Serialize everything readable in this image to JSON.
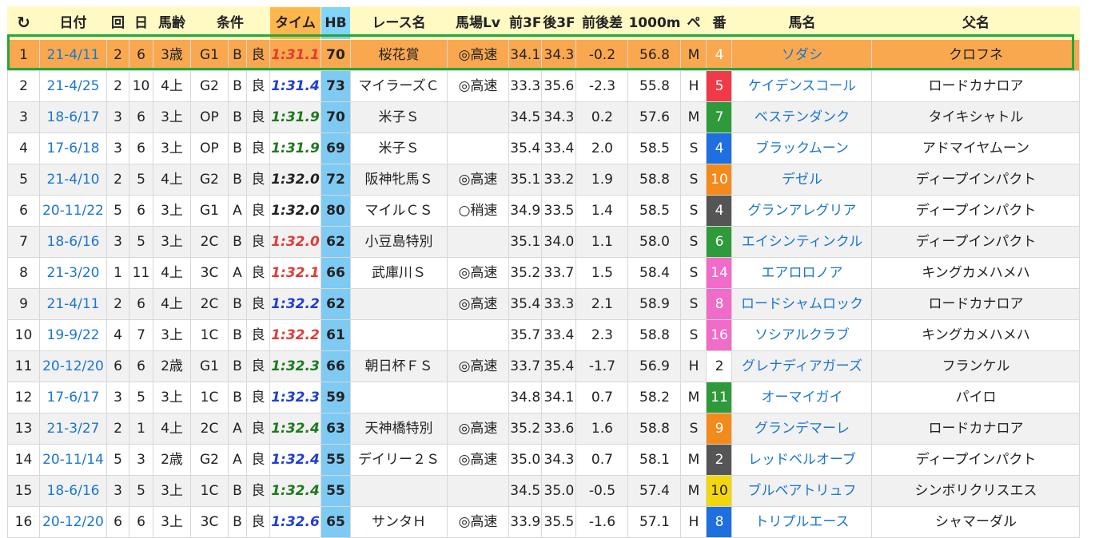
{
  "header": {
    "refresh_icon": "↻",
    "columns": [
      "日付",
      "回",
      "日",
      "馬齢",
      "条件",
      "タイム",
      "HB",
      "レース名",
      "馬場Lv",
      "前3F",
      "後3F",
      "前後差",
      "1000m",
      "ペ",
      "番",
      "馬名",
      "父名"
    ]
  },
  "colors": {
    "time_red": "#e53935",
    "time_blue": "#1e3ed6",
    "time_green": "#1b7a1b",
    "hb_bg": "#7ecaf3",
    "selected_row": "#f9a850",
    "header_bg": "#fff9c4",
    "highlight_border": "#22a83a"
  },
  "rows": [
    {
      "rank": "1",
      "date": "21-4/11",
      "kai": "2",
      "nichi": "6",
      "age": "3歳",
      "cls": "G1",
      "track": "B",
      "going": "良",
      "time": "1:31.1",
      "time_color": "#e53935",
      "hb": "70",
      "race": "桜花賞",
      "baba": "◎高速",
      "f3": "34.1",
      "l3": "34.3",
      "diff": "-0.2",
      "m1000": "56.8",
      "pace": "M",
      "num": "4",
      "num_bg": "#555555",
      "num_fg": "#ffffff",
      "horse": "ソダシ",
      "sire": "クロフネ",
      "selected": true
    },
    {
      "rank": "2",
      "date": "21-4/25",
      "kai": "2",
      "nichi": "10",
      "age": "4上",
      "cls": "G2",
      "track": "B",
      "going": "良",
      "time": "1:31.4",
      "time_color": "#1e3ed6",
      "hb": "73",
      "race": "マイラーズＣ",
      "baba": "◎高速",
      "f3": "33.3",
      "l3": "35.6",
      "diff": "-2.3",
      "m1000": "55.8",
      "pace": "H",
      "num": "5",
      "num_bg": "#f03a4a",
      "num_fg": "#ffffff",
      "horse": "ケイデンスコール",
      "sire": "ロードカナロア"
    },
    {
      "rank": "3",
      "date": "18-6/17",
      "kai": "3",
      "nichi": "6",
      "age": "3上",
      "cls": "OP",
      "track": "B",
      "going": "良",
      "time": "1:31.9",
      "time_color": "#1b7a1b",
      "hb": "70",
      "race": "米子Ｓ",
      "baba": "",
      "f3": "34.5",
      "l3": "34.3",
      "diff": "0.2",
      "m1000": "57.6",
      "pace": "M",
      "num": "7",
      "num_bg": "#2e9a3a",
      "num_fg": "#ffffff",
      "horse": "ベステンダンク",
      "sire": "タイキシャトル"
    },
    {
      "rank": "4",
      "date": "17-6/18",
      "kai": "3",
      "nichi": "6",
      "age": "3上",
      "cls": "OP",
      "track": "B",
      "going": "良",
      "time": "1:31.9",
      "time_color": "#1b7a1b",
      "hb": "69",
      "race": "米子Ｓ",
      "baba": "",
      "f3": "35.4",
      "l3": "33.4",
      "diff": "2.0",
      "m1000": "58.5",
      "pace": "S",
      "num": "4",
      "num_bg": "#1e6fe0",
      "num_fg": "#ffffff",
      "horse": "ブラックムーン",
      "sire": "アドマイヤムーン"
    },
    {
      "rank": "5",
      "date": "21-4/10",
      "kai": "2",
      "nichi": "5",
      "age": "4上",
      "cls": "G2",
      "track": "B",
      "going": "良",
      "time": "1:32.0",
      "time_color": "#222222",
      "hb": "72",
      "race": "阪神牝馬Ｓ",
      "baba": "◎高速",
      "f3": "35.1",
      "l3": "33.2",
      "diff": "1.9",
      "m1000": "58.8",
      "pace": "S",
      "num": "10",
      "num_bg": "#f38a1c",
      "num_fg": "#ffffff",
      "horse": "デゼル",
      "sire": "ディープインパクト"
    },
    {
      "rank": "6",
      "date": "20-11/22",
      "kai": "5",
      "nichi": "6",
      "age": "3上",
      "cls": "G1",
      "track": "A",
      "going": "良",
      "time": "1:32.0",
      "time_color": "#222222",
      "hb": "80",
      "race": "マイルＣＳ",
      "baba": "○稍速",
      "f3": "34.9",
      "l3": "33.5",
      "diff": "1.4",
      "m1000": "58.5",
      "pace": "S",
      "num": "4",
      "num_bg": "#555555",
      "num_fg": "#ffffff",
      "horse": "グランアレグリア",
      "sire": "ディープインパクト"
    },
    {
      "rank": "7",
      "date": "18-6/16",
      "kai": "3",
      "nichi": "5",
      "age": "3上",
      "cls": "2C",
      "track": "B",
      "going": "良",
      "time": "1:32.0",
      "time_color": "#e53935",
      "hb": "62",
      "race": "小豆島特別",
      "baba": "",
      "f3": "35.1",
      "l3": "34.0",
      "diff": "1.1",
      "m1000": "58.0",
      "pace": "S",
      "num": "6",
      "num_bg": "#2e9a3a",
      "num_fg": "#ffffff",
      "horse": "エイシンティンクル",
      "sire": "ディープインパクト"
    },
    {
      "rank": "8",
      "date": "21-3/20",
      "kai": "1",
      "nichi": "11",
      "age": "4上",
      "cls": "3C",
      "track": "A",
      "going": "良",
      "time": "1:32.1",
      "time_color": "#e53935",
      "hb": "66",
      "race": "武庫川Ｓ",
      "baba": "◎高速",
      "f3": "35.2",
      "l3": "33.7",
      "diff": "1.5",
      "m1000": "58.4",
      "pace": "S",
      "num": "14",
      "num_bg": "#f06cc8",
      "num_fg": "#ffffff",
      "horse": "エアロロノア",
      "sire": "キングカメハメハ"
    },
    {
      "rank": "9",
      "date": "21-4/11",
      "kai": "2",
      "nichi": "6",
      "age": "4上",
      "cls": "2C",
      "track": "B",
      "going": "良",
      "time": "1:32.2",
      "time_color": "#1e3ed6",
      "hb": "62",
      "race": "",
      "baba": "◎高速",
      "f3": "35.4",
      "l3": "33.3",
      "diff": "2.1",
      "m1000": "58.9",
      "pace": "S",
      "num": "8",
      "num_bg": "#f06cc8",
      "num_fg": "#ffffff",
      "horse": "ロードシャムロック",
      "sire": "ロードカナロア"
    },
    {
      "rank": "10",
      "date": "19-9/22",
      "kai": "4",
      "nichi": "7",
      "age": "3上",
      "cls": "1C",
      "track": "B",
      "going": "良",
      "time": "1:32.2",
      "time_color": "#e53935",
      "hb": "61",
      "race": "",
      "baba": "",
      "f3": "35.7",
      "l3": "33.4",
      "diff": "2.3",
      "m1000": "58.8",
      "pace": "S",
      "num": "16",
      "num_bg": "#f06cc8",
      "num_fg": "#ffffff",
      "horse": "ソシアルクラブ",
      "sire": "キングカメハメハ"
    },
    {
      "rank": "11",
      "date": "20-12/20",
      "kai": "6",
      "nichi": "6",
      "age": "2歳",
      "cls": "G1",
      "track": "B",
      "going": "良",
      "time": "1:32.3",
      "time_color": "#1b7a1b",
      "hb": "66",
      "race": "朝日杯ＦＳ",
      "baba": "◎高速",
      "f3": "33.7",
      "l3": "35.4",
      "diff": "-1.7",
      "m1000": "56.9",
      "pace": "H",
      "num": "2",
      "num_bg": "#ffffff",
      "num_fg": "#222222",
      "horse": "グレナディアガーズ",
      "sire": "フランケル"
    },
    {
      "rank": "12",
      "date": "17-6/17",
      "kai": "3",
      "nichi": "5",
      "age": "3上",
      "cls": "1C",
      "track": "B",
      "going": "良",
      "time": "1:32.3",
      "time_color": "#1e3ed6",
      "hb": "59",
      "race": "",
      "baba": "",
      "f3": "34.8",
      "l3": "34.1",
      "diff": "0.7",
      "m1000": "58.2",
      "pace": "M",
      "num": "11",
      "num_bg": "#2e9a3a",
      "num_fg": "#ffffff",
      "horse": "オーマイガイ",
      "sire": "パイロ"
    },
    {
      "rank": "13",
      "date": "21-3/27",
      "kai": "2",
      "nichi": "1",
      "age": "4上",
      "cls": "2C",
      "track": "A",
      "going": "良",
      "time": "1:32.4",
      "time_color": "#1b7a1b",
      "hb": "63",
      "race": "天神橋特別",
      "baba": "◎高速",
      "f3": "35.2",
      "l3": "33.6",
      "diff": "1.6",
      "m1000": "58.8",
      "pace": "S",
      "num": "9",
      "num_bg": "#f38a1c",
      "num_fg": "#ffffff",
      "horse": "グランデマーレ",
      "sire": "ロードカナロア"
    },
    {
      "rank": "14",
      "date": "20-11/14",
      "kai": "5",
      "nichi": "3",
      "age": "2歳",
      "cls": "G2",
      "track": "A",
      "going": "良",
      "time": "1:32.4",
      "time_color": "#1e3ed6",
      "hb": "55",
      "race": "デイリー２Ｓ",
      "baba": "◎高速",
      "f3": "35.0",
      "l3": "34.3",
      "diff": "0.7",
      "m1000": "58.1",
      "pace": "M",
      "num": "2",
      "num_bg": "#555555",
      "num_fg": "#ffffff",
      "horse": "レッドベルオーブ",
      "sire": "ディープインパクト"
    },
    {
      "rank": "15",
      "date": "18-6/16",
      "kai": "3",
      "nichi": "5",
      "age": "3上",
      "cls": "1C",
      "track": "B",
      "going": "良",
      "time": "1:32.4",
      "time_color": "#1b7a1b",
      "hb": "55",
      "race": "",
      "baba": "",
      "f3": "34.5",
      "l3": "35.0",
      "diff": "-0.5",
      "m1000": "57.4",
      "pace": "M",
      "num": "10",
      "num_bg": "#f2d60e",
      "num_fg": "#222222",
      "horse": "ブルベアトリュフ",
      "sire": "シンボリクリスエス"
    },
    {
      "rank": "16",
      "date": "20-12/20",
      "kai": "6",
      "nichi": "6",
      "age": "3上",
      "cls": "3C",
      "track": "B",
      "going": "良",
      "time": "1:32.6",
      "time_color": "#1e3ed6",
      "hb": "65",
      "race": "サンタＨ",
      "baba": "◎高速",
      "f3": "33.9",
      "l3": "35.5",
      "diff": "-1.6",
      "m1000": "57.1",
      "pace": "H",
      "num": "8",
      "num_bg": "#1e6fe0",
      "num_fg": "#ffffff",
      "horse": "トリプルエース",
      "sire": "シャマーダル"
    }
  ]
}
